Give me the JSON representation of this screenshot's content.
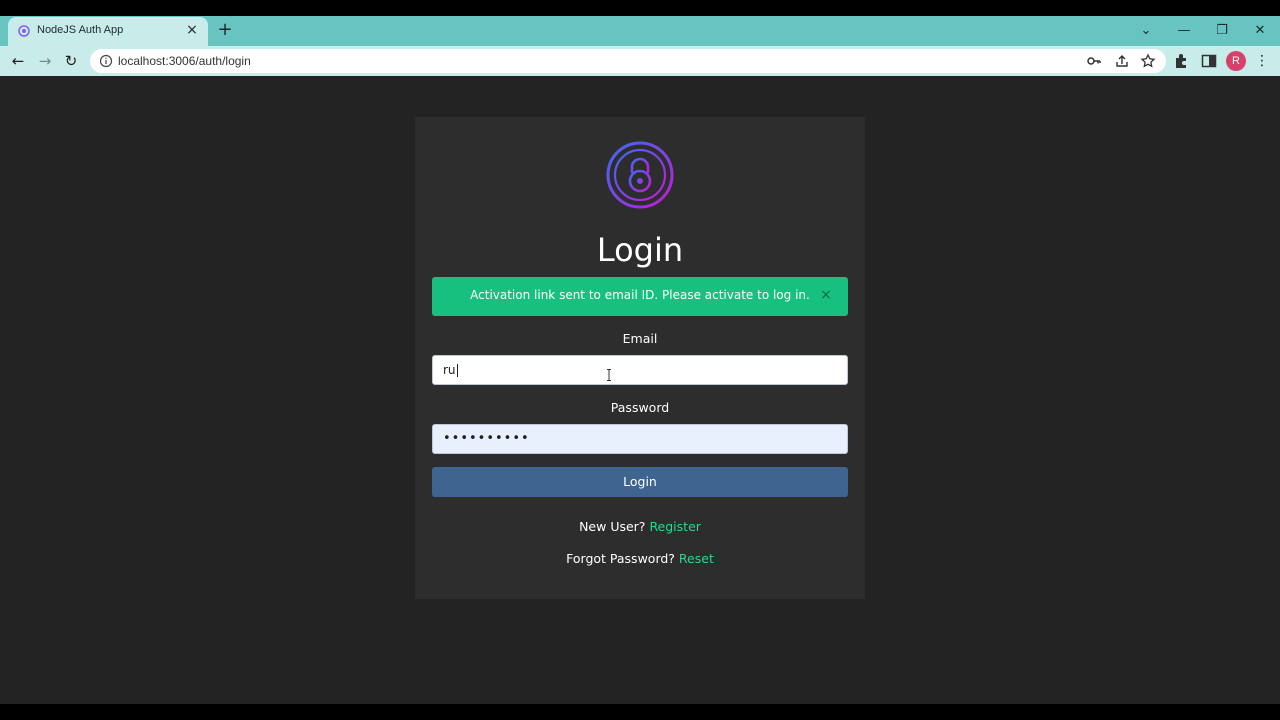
{
  "browser": {
    "tab": {
      "title": "NodeJS Auth App",
      "close": "×"
    },
    "new_tab": "+",
    "window_controls": {
      "minimize": "—",
      "restore": "❐",
      "close": "✕",
      "tab_search": "⌄"
    },
    "nav": {
      "back": "←",
      "forward": "→",
      "reload": "↻"
    },
    "url": "localhost:3006/auth/login",
    "profile_initial": "R",
    "menu": "⋮",
    "icons": [
      "key-icon",
      "share-icon",
      "star-icon",
      "extensions-icon",
      "side-panel-icon"
    ]
  },
  "login": {
    "title": "Login",
    "alert": {
      "message": "Activation link sent to email ID. Please activate to log in.",
      "close": "×",
      "color": "#18c07f"
    },
    "email_label": "Email",
    "email_value": "ru",
    "password_label": "Password",
    "password_value": "••••••••••",
    "submit_label": "Login",
    "register_prompt": "New User?",
    "register_link": "Register",
    "reset_prompt": "Forgot Password?",
    "reset_link": "Reset",
    "accent_color": "#2fd58f",
    "button_color": "#3e6590"
  }
}
